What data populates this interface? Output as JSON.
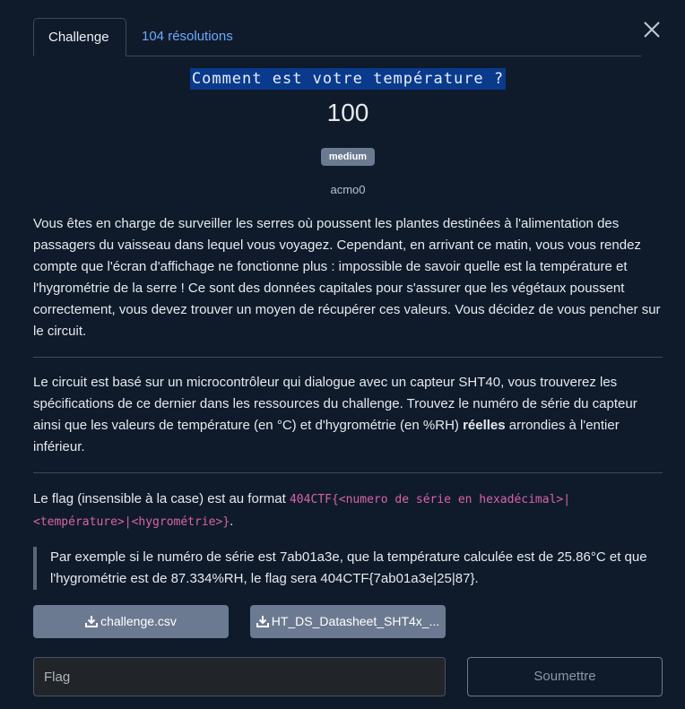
{
  "tabs": {
    "challenge": "Challenge",
    "solves": "104 résolutions"
  },
  "challenge": {
    "title": "Comment est votre température ?",
    "points": "100",
    "difficulty": "medium",
    "author": "acmo0"
  },
  "description": {
    "paragraph1": "Vous êtes en charge de surveiller les serres où poussent les plantes destinées à l'alimentation des passagers du vaisseau dans lequel vous voyagez. Cependant, en arrivant ce matin, vous vous rendez compte que l'écran d'affichage ne fonctionne plus : impossible de savoir quelle est la température et l'hygrométrie de la serre ! Ce sont des données capitales pour s'assurer que les végétaux poussent correctement, vous devez trouver un moyen de récupérer ces valeurs. Vous décidez de vous pencher sur le circuit.",
    "paragraph2_before": "Le circuit est basé sur un microcontrôleur qui dialogue avec un capteur SHT40, vous trouverez les spécifications de ce dernier dans les ressources du challenge. Trouvez le numéro de série du capteur ainsi que les valeurs de température (en °C) et d'hygrométrie (en %RH) ",
    "paragraph2_bold": "réelles",
    "paragraph2_after": " arrondies à l'entier inférieur.",
    "paragraph3_before": "Le flag (insensible à la case) est au format ",
    "paragraph3_code": "404CTF{<numero de série en hexadécimal>|<température>|<hygrométrie>}",
    "paragraph3_after": ".",
    "example": "Par exemple si le numéro de série est 7ab01a3e, que la température calculée est de 25.86°C et que l'hygrométrie est de 87.334%RH, le flag sera 404CTF{7ab01a3e|25|87}."
  },
  "files": [
    {
      "label": "challenge.csv",
      "icon": "download-icon"
    },
    {
      "label": "HT_DS_Datasheet_SHT4x_...",
      "icon": "download-icon"
    }
  ],
  "form": {
    "flag_placeholder": "Flag",
    "submit_label": "Soumettre"
  },
  "colors": {
    "background": "#0f1b2b",
    "link": "#6ea8fe",
    "title_highlight": "#0a3a8c",
    "badge": "#6c7a91",
    "code": "#d963a7"
  }
}
